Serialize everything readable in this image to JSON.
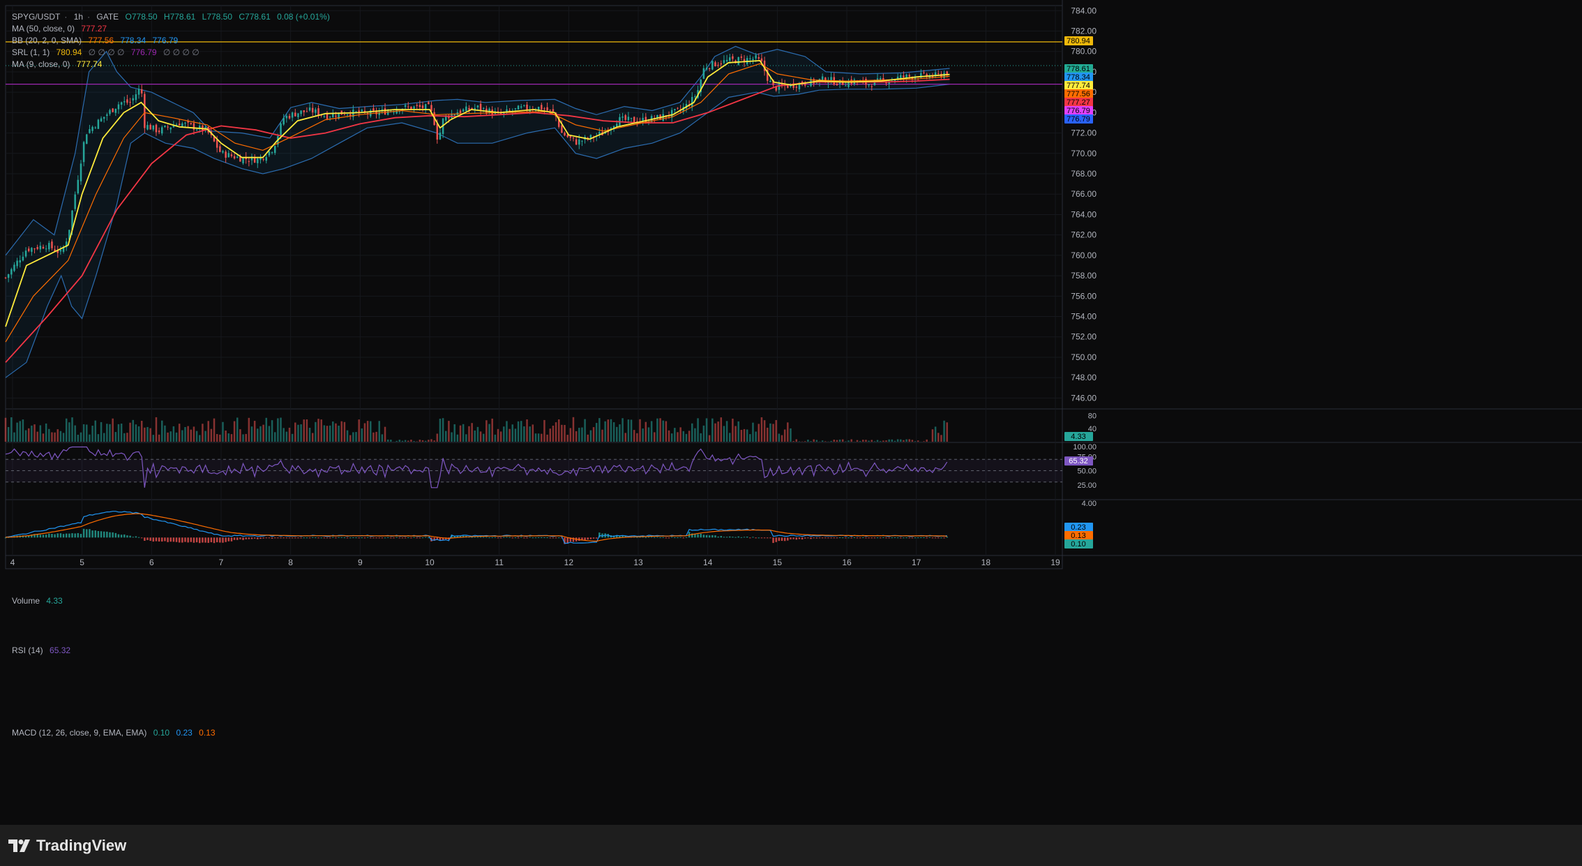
{
  "header": {
    "symbol": "SPYG/USDT",
    "interval": "1h",
    "exchange": "GATE",
    "open": "O778.50",
    "high": "H778.61",
    "low": "L778.50",
    "close": "C778.61",
    "change": "0.08 (+0.01%)"
  },
  "indicators": {
    "ma50": {
      "label": "MA (50, close, 0)",
      "value": "777.27"
    },
    "bb": {
      "label": "BB (20, 2, 0, SMA)",
      "v1": "777.56",
      "v2": "778.34",
      "v3": "776.79"
    },
    "srl": {
      "label": "SRL (1, 1)",
      "value": "780.94",
      "extra": "∅ ∅ ∅ ∅",
      "value2": "776.79",
      "extra2": "∅ ∅ ∅ ∅"
    },
    "ma9": {
      "label": "MA (9, close, 0)",
      "value": "777.74"
    }
  },
  "price_axis": {
    "ticks": [
      "784.00",
      "782.00",
      "780.00",
      "778.00",
      "776.00",
      "774.00",
      "772.00",
      "770.00",
      "768.00",
      "766.00",
      "764.00",
      "762.00",
      "760.00",
      "758.00",
      "756.00",
      "754.00",
      "752.00",
      "750.00",
      "748.00",
      "746.00"
    ],
    "tags": [
      {
        "value": "780.94",
        "color": "#f0b90b"
      },
      {
        "value": "778.61",
        "color": "#22ab94"
      },
      {
        "value": "778.34",
        "color": "#2196f3"
      },
      {
        "value": "777.74",
        "color": "#ffeb3b"
      },
      {
        "value": "777.56",
        "color": "#ff6d00"
      },
      {
        "value": "777.27",
        "color": "#f23645"
      },
      {
        "value": "776.79",
        "color": "#e040fb"
      },
      {
        "value": "776.79",
        "color": "#2962ff"
      }
    ]
  },
  "volume_pane": {
    "label": "Volume",
    "value": "4.33",
    "ticks": [
      "80",
      "40"
    ],
    "tag": "4.33"
  },
  "rsi_pane": {
    "label": "RSI (14)",
    "value": "65.32",
    "ticks": [
      "100.00",
      "75.00",
      "50.00",
      "25.00"
    ],
    "tag": "65.32"
  },
  "macd_pane": {
    "label": "MACD (12, 26, close, 9, EMA, EMA)",
    "hist": "0.10",
    "macd": "0.23",
    "signal": "0.13",
    "ticks": [
      "4.00"
    ],
    "tags": [
      {
        "value": "0.23",
        "color": "#2196f3"
      },
      {
        "value": "0.13",
        "color": "#ff6d00"
      },
      {
        "value": "0.10",
        "color": "#26a69a"
      }
    ]
  },
  "time_axis": {
    "labels": [
      "4",
      "5",
      "6",
      "7",
      "8",
      "9",
      "10",
      "11",
      "12",
      "13",
      "14",
      "15",
      "16",
      "17",
      "18",
      "19"
    ]
  },
  "brand": {
    "name": "TradingView"
  },
  "colors": {
    "up": "#26a69a",
    "down": "#ef5350",
    "ma9": "#ffeb3b",
    "ma50": "#f23645",
    "ema": "#ff6d00",
    "bb": "#2962ff",
    "bbfill": "rgba(33,150,243,0.08)",
    "srl": "#f0b90b",
    "srl2": "#9c27b0",
    "rsi": "#7e57c2"
  },
  "chart_data": {
    "type": "candlestick",
    "symbol": "SPYG/USDT",
    "interval": "1h",
    "price_range": [
      745,
      784.5
    ],
    "x_range_days": [
      3.9,
      19.1
    ],
    "price_path_close": [
      [
        3.9,
        757.8
      ],
      [
        4.2,
        760.6
      ],
      [
        4.5,
        761.0
      ],
      [
        4.7,
        760.2
      ],
      [
        4.8,
        762.0
      ],
      [
        4.95,
        768.0
      ],
      [
        5.05,
        772.0
      ],
      [
        5.3,
        773.5
      ],
      [
        5.55,
        775.0
      ],
      [
        5.7,
        775.0
      ],
      [
        5.77,
        775.8
      ],
      [
        5.85,
        776.5
      ],
      [
        5.9,
        772.8
      ],
      [
        6.1,
        772.2
      ],
      [
        6.4,
        773.0
      ],
      [
        6.6,
        772.6
      ],
      [
        6.8,
        772.2
      ],
      [
        7.0,
        770.0
      ],
      [
        7.3,
        769.5
      ],
      [
        7.55,
        769.4
      ],
      [
        7.75,
        770.5
      ],
      [
        7.9,
        773.5
      ],
      [
        8.1,
        774.0
      ],
      [
        8.3,
        774.2
      ],
      [
        8.5,
        773.7
      ],
      [
        8.8,
        774.0
      ],
      [
        9.2,
        773.9
      ],
      [
        9.6,
        774.5
      ],
      [
        10.0,
        774.5
      ],
      [
        10.07,
        773.0
      ],
      [
        10.12,
        771.2
      ],
      [
        10.2,
        773.5
      ],
      [
        10.4,
        774.1
      ],
      [
        10.7,
        774.5
      ],
      [
        11.0,
        773.8
      ],
      [
        11.3,
        774.4
      ],
      [
        11.6,
        774.5
      ],
      [
        11.8,
        773.9
      ],
      [
        11.9,
        772.0
      ],
      [
        12.1,
        771.1
      ],
      [
        12.3,
        771.5
      ],
      [
        12.5,
        772.0
      ],
      [
        12.7,
        773.3
      ],
      [
        13.0,
        773.2
      ],
      [
        13.3,
        773.5
      ],
      [
        13.6,
        774.2
      ],
      [
        13.75,
        775.0
      ],
      [
        13.85,
        776.0
      ],
      [
        13.95,
        778.5
      ],
      [
        14.1,
        778.8
      ],
      [
        14.3,
        779.1
      ],
      [
        14.5,
        779.2
      ],
      [
        14.7,
        779.3
      ],
      [
        14.78,
        778.8
      ],
      [
        14.85,
        777.5
      ],
      [
        14.95,
        776.4
      ],
      [
        15.1,
        776.6
      ],
      [
        15.3,
        776.8
      ],
      [
        15.5,
        777.0
      ],
      [
        15.7,
        777.3
      ],
      [
        15.9,
        776.9
      ],
      [
        16.1,
        777.1
      ],
      [
        16.3,
        776.8
      ],
      [
        16.5,
        777.1
      ],
      [
        16.8,
        777.5
      ],
      [
        17.0,
        777.6
      ],
      [
        17.3,
        777.6
      ],
      [
        17.45,
        778.0
      ],
      [
        17.48,
        778.61
      ]
    ],
    "ma9_path": [
      [
        3.9,
        753.0
      ],
      [
        4.2,
        759.0
      ],
      [
        4.5,
        760.0
      ],
      [
        4.8,
        761.0
      ],
      [
        5.0,
        766.0
      ],
      [
        5.3,
        771.5
      ],
      [
        5.6,
        774.0
      ],
      [
        5.85,
        775.0
      ],
      [
        6.1,
        773.2
      ],
      [
        6.4,
        772.6
      ],
      [
        6.8,
        772.4
      ],
      [
        7.0,
        771.0
      ],
      [
        7.3,
        769.6
      ],
      [
        7.6,
        769.6
      ],
      [
        7.8,
        771.2
      ],
      [
        8.1,
        773.2
      ],
      [
        8.5,
        773.9
      ],
      [
        9.0,
        774.0
      ],
      [
        9.5,
        774.3
      ],
      [
        10.0,
        774.3
      ],
      [
        10.15,
        772.5
      ],
      [
        10.3,
        773.3
      ],
      [
        10.6,
        774.3
      ],
      [
        11.0,
        774.0
      ],
      [
        11.5,
        774.3
      ],
      [
        11.8,
        774.0
      ],
      [
        12.0,
        771.8
      ],
      [
        12.3,
        771.4
      ],
      [
        12.7,
        772.6
      ],
      [
        13.1,
        773.2
      ],
      [
        13.5,
        773.8
      ],
      [
        13.8,
        775.0
      ],
      [
        14.0,
        777.5
      ],
      [
        14.3,
        778.9
      ],
      [
        14.75,
        779.1
      ],
      [
        14.95,
        777.0
      ],
      [
        15.2,
        776.7
      ],
      [
        15.6,
        777.1
      ],
      [
        16.0,
        777.0
      ],
      [
        16.5,
        777.1
      ],
      [
        17.0,
        777.5
      ],
      [
        17.48,
        777.74
      ]
    ],
    "ema_path": [
      [
        3.9,
        751.5
      ],
      [
        4.3,
        756.0
      ],
      [
        4.8,
        759.5
      ],
      [
        5.2,
        766.0
      ],
      [
        5.6,
        771.5
      ],
      [
        5.9,
        774.0
      ],
      [
        6.3,
        773.5
      ],
      [
        6.8,
        772.8
      ],
      [
        7.2,
        771.0
      ],
      [
        7.6,
        770.3
      ],
      [
        8.0,
        771.6
      ],
      [
        8.5,
        773.3
      ],
      [
        9.0,
        773.8
      ],
      [
        9.6,
        774.2
      ],
      [
        10.1,
        773.8
      ],
      [
        10.5,
        773.9
      ],
      [
        11.0,
        774.0
      ],
      [
        11.7,
        774.1
      ],
      [
        12.1,
        772.8
      ],
      [
        12.5,
        772.2
      ],
      [
        13.0,
        772.9
      ],
      [
        13.5,
        773.6
      ],
      [
        13.9,
        775.0
      ],
      [
        14.3,
        777.8
      ],
      [
        14.75,
        778.8
      ],
      [
        15.0,
        777.8
      ],
      [
        15.5,
        777.2
      ],
      [
        16.0,
        777.1
      ],
      [
        17.0,
        777.3
      ],
      [
        17.48,
        777.56
      ]
    ],
    "ma50_path": [
      [
        3.9,
        749.5
      ],
      [
        4.5,
        754.0
      ],
      [
        5.0,
        758.0
      ],
      [
        5.5,
        764.5
      ],
      [
        6.0,
        769.0
      ],
      [
        6.5,
        771.8
      ],
      [
        7.0,
        772.7
      ],
      [
        7.5,
        772.3
      ],
      [
        8.0,
        771.5
      ],
      [
        8.5,
        772.0
      ],
      [
        9.0,
        772.9
      ],
      [
        9.5,
        773.5
      ],
      [
        10.0,
        773.7
      ],
      [
        10.5,
        773.6
      ],
      [
        11.0,
        773.8
      ],
      [
        11.5,
        774.0
      ],
      [
        12.0,
        773.7
      ],
      [
        12.5,
        773.2
      ],
      [
        13.0,
        773.0
      ],
      [
        13.5,
        773.0
      ],
      [
        14.0,
        774.0
      ],
      [
        14.5,
        775.3
      ],
      [
        15.0,
        776.6
      ],
      [
        15.5,
        777.0
      ],
      [
        16.0,
        777.0
      ],
      [
        16.5,
        777.0
      ],
      [
        17.0,
        777.1
      ],
      [
        17.48,
        777.27
      ]
    ],
    "bb_upper_path": [
      [
        3.9,
        760.0
      ],
      [
        4.3,
        763.5
      ],
      [
        4.6,
        762.0
      ],
      [
        4.9,
        770.0
      ],
      [
        5.1,
        778.0
      ],
      [
        5.35,
        780.0
      ],
      [
        5.5,
        778.0
      ],
      [
        5.7,
        776.5
      ],
      [
        6.0,
        776.0
      ],
      [
        6.3,
        775.0
      ],
      [
        6.6,
        774.0
      ],
      [
        6.85,
        772.2
      ],
      [
        7.3,
        772.0
      ],
      [
        7.7,
        771.5
      ],
      [
        8.0,
        774.5
      ],
      [
        8.3,
        775.0
      ],
      [
        8.7,
        774.4
      ],
      [
        9.1,
        774.6
      ],
      [
        9.6,
        774.8
      ],
      [
        10.1,
        775.2
      ],
      [
        10.4,
        775.3
      ],
      [
        10.8,
        775.0
      ],
      [
        11.3,
        775.2
      ],
      [
        11.8,
        775.3
      ],
      [
        12.1,
        774.4
      ],
      [
        12.4,
        773.8
      ],
      [
        12.8,
        774.6
      ],
      [
        13.2,
        774.2
      ],
      [
        13.6,
        775.0
      ],
      [
        13.9,
        777.5
      ],
      [
        14.1,
        779.5
      ],
      [
        14.4,
        780.5
      ],
      [
        14.7,
        779.7
      ],
      [
        15.0,
        780.2
      ],
      [
        15.4,
        779.5
      ],
      [
        15.7,
        778.0
      ],
      [
        16.2,
        777.8
      ],
      [
        16.8,
        777.9
      ],
      [
        17.48,
        778.34
      ]
    ],
    "bb_lower_path": [
      [
        3.9,
        748.0
      ],
      [
        4.2,
        749.5
      ],
      [
        4.5,
        755.0
      ],
      [
        4.7,
        758.0
      ],
      [
        4.85,
        755.0
      ],
      [
        5.0,
        753.8
      ],
      [
        5.2,
        758.0
      ],
      [
        5.5,
        765.0
      ],
      [
        5.7,
        771.0
      ],
      [
        5.9,
        772.0
      ],
      [
        6.2,
        771.0
      ],
      [
        6.6,
        770.5
      ],
      [
        6.9,
        769.5
      ],
      [
        7.3,
        768.5
      ],
      [
        7.6,
        768.0
      ],
      [
        7.9,
        768.5
      ],
      [
        8.3,
        769.5
      ],
      [
        8.7,
        771.0
      ],
      [
        9.1,
        772.5
      ],
      [
        9.6,
        773.0
      ],
      [
        10.1,
        772.0
      ],
      [
        10.4,
        771.0
      ],
      [
        10.9,
        771.0
      ],
      [
        11.4,
        772.0
      ],
      [
        11.8,
        772.5
      ],
      [
        12.1,
        770.0
      ],
      [
        12.4,
        769.5
      ],
      [
        12.8,
        770.5
      ],
      [
        13.2,
        771.0
      ],
      [
        13.6,
        772.0
      ],
      [
        13.9,
        773.5
      ],
      [
        14.3,
        775.5
      ],
      [
        14.7,
        776.0
      ],
      [
        14.95,
        775.6
      ],
      [
        15.3,
        775.8
      ],
      [
        15.6,
        776.2
      ],
      [
        16.0,
        776.3
      ],
      [
        16.5,
        776.3
      ],
      [
        17.0,
        776.4
      ],
      [
        17.48,
        776.79
      ]
    ],
    "srl_levels": [
      780.94,
      776.79
    ],
    "volume_range": [
      0,
      100
    ],
    "rsi_range": [
      0,
      100
    ],
    "rsi_bands": [
      70,
      50,
      30
    ],
    "rsi_last": 65.32,
    "macd_range": [
      -2.0,
      4.4
    ],
    "macd_last": {
      "hist": 0.1,
      "macd": 0.23,
      "signal": 0.13
    }
  }
}
